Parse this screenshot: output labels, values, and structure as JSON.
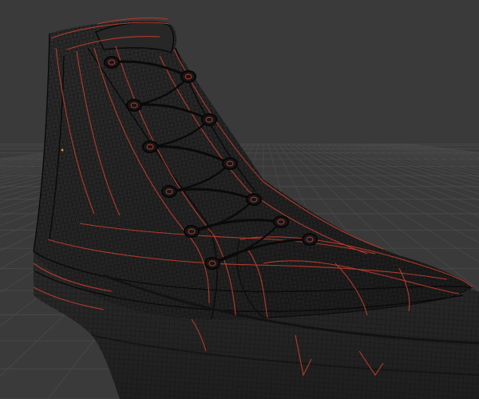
{
  "scene": {
    "background": "#3a3a3a",
    "grid_color": "#4a4a4a",
    "mesh_base": "#232323",
    "wire_color": "#000000",
    "seam_color": "#c0392b",
    "highlight_color": "#e0a030"
  },
  "objects": [
    {
      "name": "high-top-sneaker",
      "display": "wireframe",
      "selected": false
    }
  ]
}
